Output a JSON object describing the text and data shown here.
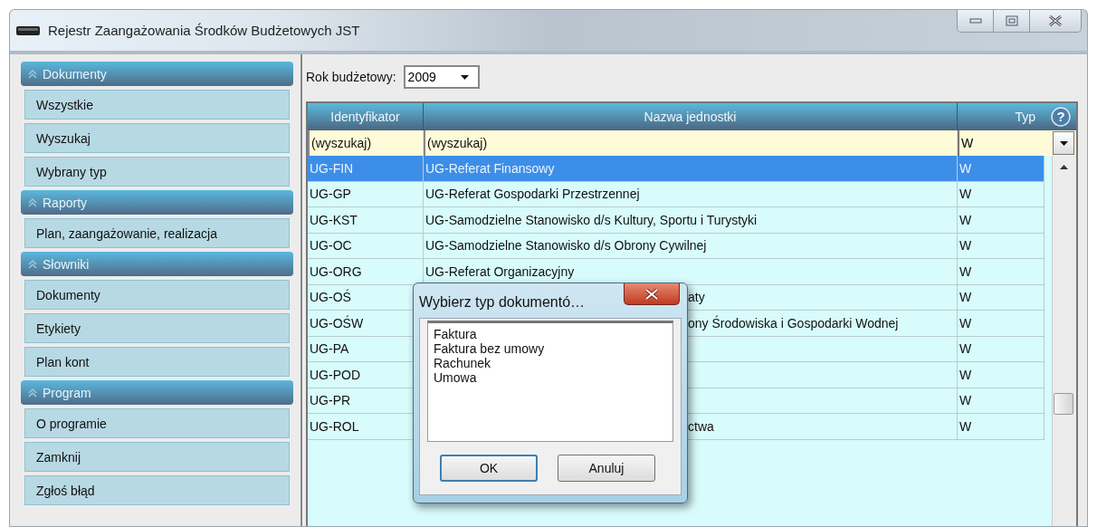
{
  "window": {
    "title": "Rejestr Zaangażowania Środków Budżetowych JST"
  },
  "sidebar": {
    "sections": [
      {
        "title": "Dokumenty",
        "items": [
          "Wszystkie",
          "Wyszukaj",
          "Wybrany typ"
        ]
      },
      {
        "title": "Raporty",
        "items": [
          "Plan, zaangażowanie, realizacja"
        ]
      },
      {
        "title": "Słowniki",
        "items": [
          "Dokumenty",
          "Etykiety",
          "Plan kont"
        ]
      },
      {
        "title": "Program",
        "items": [
          "O programie",
          "Zamknij",
          "Zgłoś błąd"
        ]
      }
    ]
  },
  "year": {
    "label": "Rok budżetowy:",
    "value": "2009"
  },
  "table": {
    "columns": [
      "Identyfikator",
      "Nazwa jednostki",
      "Typ"
    ],
    "help": "?",
    "filters": [
      "(wyszukaj)",
      "(wyszukaj)",
      "W"
    ],
    "rows": [
      {
        "id": "UG-FIN",
        "name": "UG-Referat Finansowy",
        "type": "W",
        "selected": true
      },
      {
        "id": "UG-GP",
        "name": "UG-Referat Gospodarki Przestrzennej",
        "type": "W",
        "selected": false
      },
      {
        "id": "UG-KST",
        "name": "UG-Samodzielne Stanowisko d/s Kultury, Sportu i Turystyki",
        "type": "W",
        "selected": false
      },
      {
        "id": "UG-OC",
        "name": "UG-Samodzielne Stanowisko d/s Obrony Cywilnej",
        "type": "W",
        "selected": false
      },
      {
        "id": "UG-ORG",
        "name": "UG-Referat Organizacyjny",
        "type": "W",
        "selected": false
      },
      {
        "id": "UG-OŚ",
        "name": "aty",
        "type": "W",
        "selected": false,
        "covered": true
      },
      {
        "id": "UG-OŚW",
        "name": "ony Środowiska i Gospodarki Wodnej",
        "type": "W",
        "selected": false,
        "covered": true
      },
      {
        "id": "UG-PA",
        "type": "W",
        "selected": false
      },
      {
        "id": "UG-POD",
        "type": "W",
        "selected": false
      },
      {
        "id": "UG-PR",
        "type": "W",
        "selected": false
      },
      {
        "id": "UG-ROL",
        "name": "ctwa",
        "type": "W",
        "selected": false,
        "covered": true
      }
    ]
  },
  "dialog": {
    "title": "Wybierz typ dokumentó…",
    "options": [
      "Faktura",
      "Faktura bez umowy",
      "Rachunek",
      "Umowa"
    ],
    "buttons": [
      "OK",
      "Anuluj"
    ]
  }
}
